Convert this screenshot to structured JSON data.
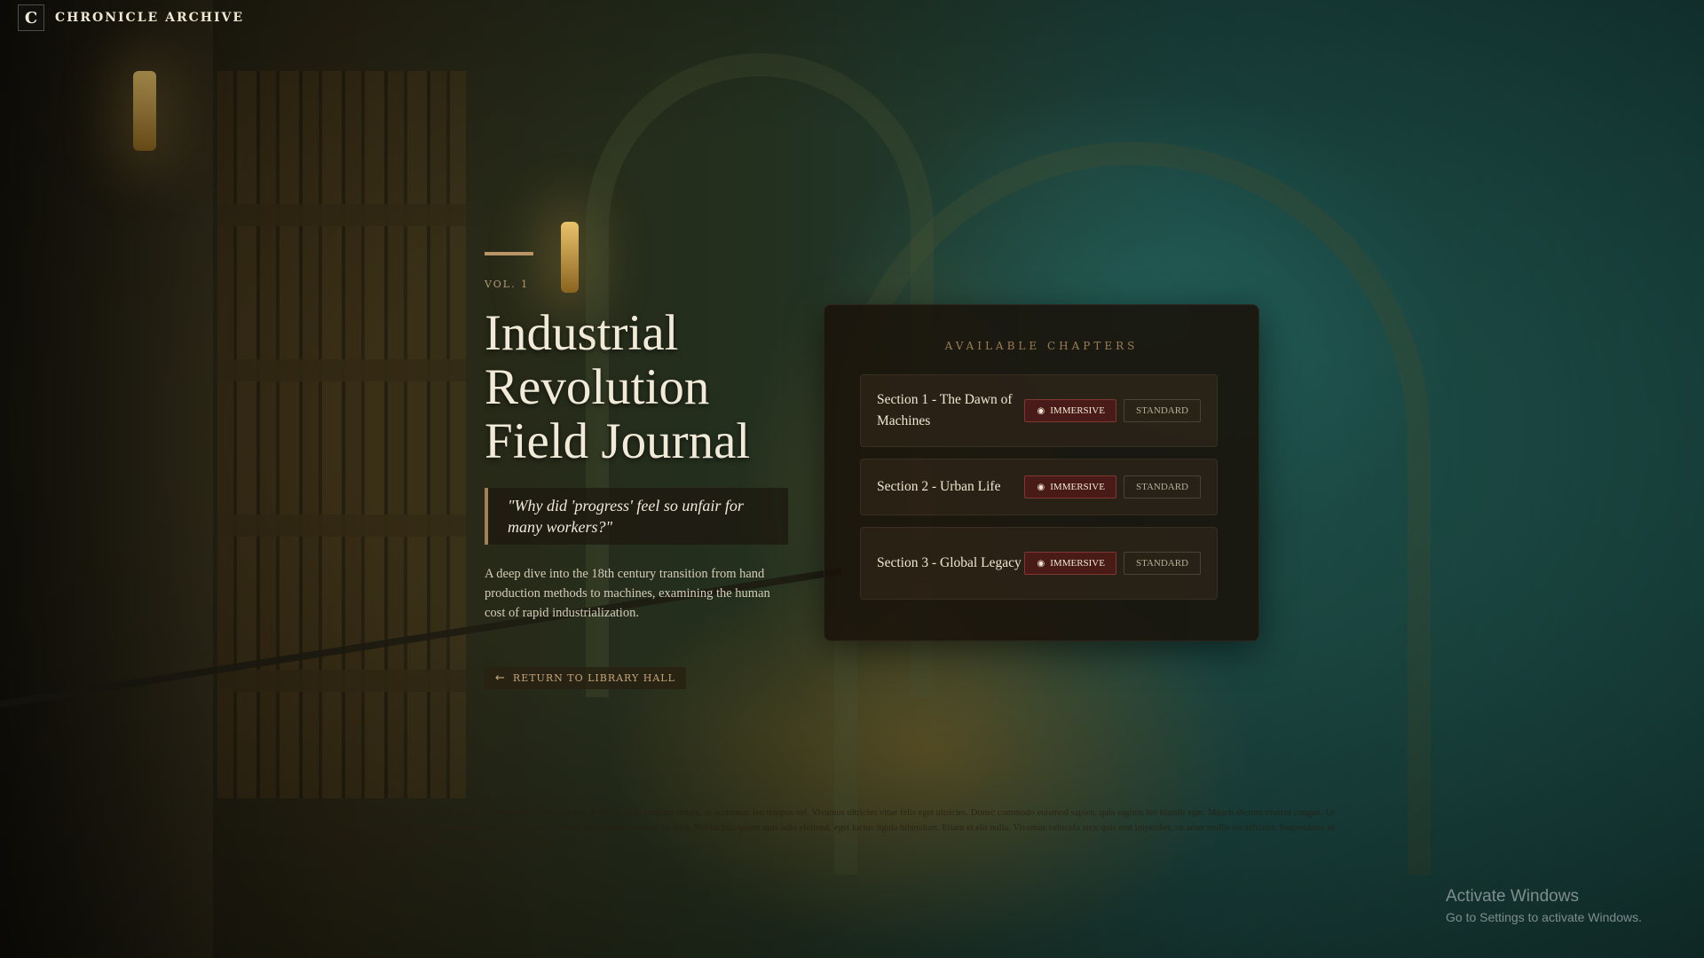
{
  "brand": {
    "logo_letter": "C",
    "name": "CHRONICLE ARCHIVE"
  },
  "hero": {
    "volume": "VOL. 1",
    "title_lines": [
      "Industrial",
      "Revolution",
      "Field Journal"
    ],
    "quote": "\"Why did 'progress' feel so unfair for many workers?\"",
    "description": "A deep dive into the 18th century transition from hand production methods to machines, examining the human cost of rapid industrialization."
  },
  "return_button": {
    "label": "RETURN TO LIBRARY HALL",
    "icon": "arrow-left-icon"
  },
  "chapters_panel": {
    "heading": "AVAILABLE CHAPTERS",
    "immersive_label": "IMMERSIVE",
    "standard_label": "STANDARD",
    "chapters": [
      {
        "title": "Section 1 - The Dawn of Machines"
      },
      {
        "title": "Section 2 - Urban Life"
      },
      {
        "title": "Section 3 - Global Legacy"
      }
    ]
  },
  "footer_text": "Lorem ipsum dolor sit amet, consectetur adipiscing elit. Nulla facilisis pretium ornare, in accumsan leo tempus vel. Vivamus ultricies vitae felis eget ultricies. Donec commodo euismod sapien, quis sagittis leo blandit eget. Mauris dictum viverra congue. Ut pharetra vestibulum luctus nunc eget facilisis. Nullam vestibulum pulvinar facilisis. Sed lacinia ipsum quis odio eleifend, eget luctus ligula bibendum. Etiam et elit nulla. Vivamus vehicula arcu quis erat imperdiet, sit amet mollis est efficitur. Suspendisse id arcu ac mauris tempor accumsan sed non massa.",
  "watermark": {
    "title": "Activate Windows",
    "subtitle": "Go to Settings to activate Windows."
  },
  "colors": {
    "accent": "#b89466",
    "immersive_bg": "#5a1919",
    "panel_bg": "#19120a"
  }
}
